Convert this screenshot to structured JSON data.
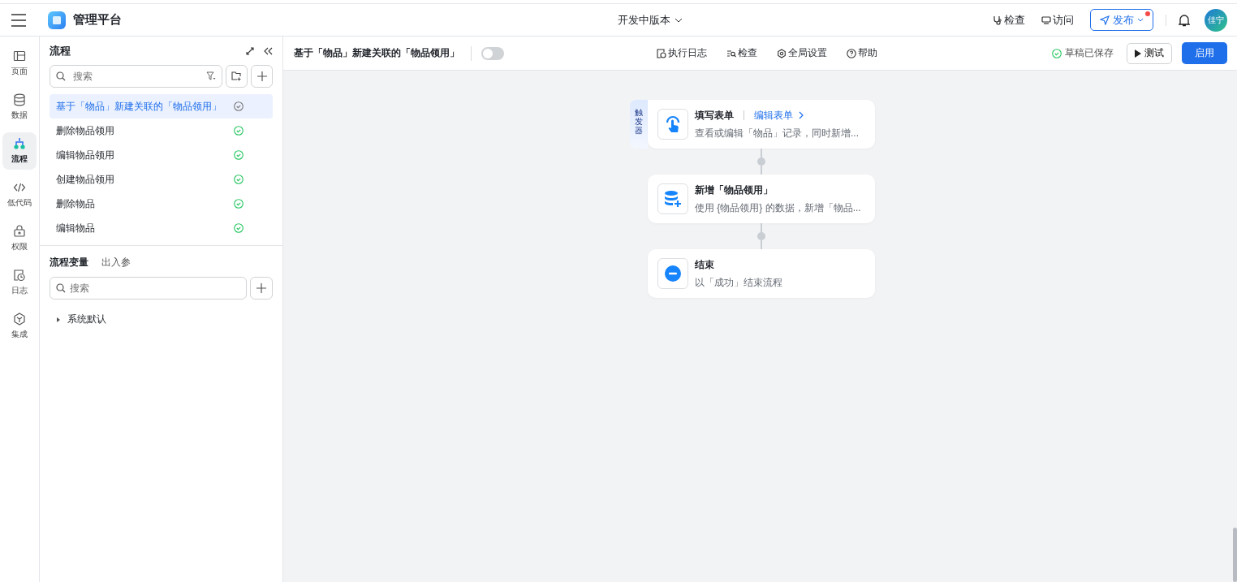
{
  "header": {
    "app_name": "管理平台",
    "version": "开发中版本",
    "actions": [
      {
        "kind": "check",
        "label": "检查"
      },
      {
        "kind": "visit",
        "label": "访问"
      }
    ],
    "publish": {
      "label": "发布",
      "has_dot": true
    },
    "avatar": "佳宁"
  },
  "rail": [
    {
      "kind": "page",
      "label": "页面",
      "selected": false
    },
    {
      "kind": "data",
      "label": "数据",
      "selected": false
    },
    {
      "kind": "flow",
      "label": "流程",
      "selected": true
    },
    {
      "kind": "code",
      "label": "低代码",
      "selected": false
    },
    {
      "kind": "lock",
      "label": "权限",
      "selected": false
    },
    {
      "kind": "log",
      "label": "日志",
      "selected": false
    },
    {
      "kind": "box",
      "label": "集成",
      "selected": false
    }
  ],
  "panel": {
    "title": "流程",
    "search": {
      "placeholder": "搜索"
    },
    "flows": [
      {
        "name": "基于「物品」新建关联的「物品领用」",
        "selected": true
      },
      {
        "name": "删除物品领用",
        "selected": false
      },
      {
        "name": "编辑物品领用",
        "selected": false
      },
      {
        "name": "创建物品领用",
        "selected": false
      },
      {
        "name": "删除物品",
        "selected": false
      },
      {
        "name": "编辑物品",
        "selected": false
      }
    ],
    "var_tabs": [
      {
        "label": "流程变量",
        "selected": true
      },
      {
        "label": "出入参",
        "selected": false
      }
    ],
    "var_search": {
      "placeholder": "搜索"
    },
    "tree": [
      {
        "label": "系统默认",
        "expanded": false
      }
    ]
  },
  "toolbar": {
    "title": "基于「物品」新建关联的「物品领用」",
    "toggle_on": false,
    "tools": [
      {
        "kind": "log",
        "label": "执行日志"
      },
      {
        "kind": "check",
        "label": "检查"
      },
      {
        "kind": "settings",
        "label": "全局设置"
      },
      {
        "kind": "help",
        "label": "帮助"
      }
    ],
    "saved": "草稿已保存",
    "test": "测试",
    "enable": "启用"
  },
  "nodes": [
    {
      "kind": "trigger",
      "badge": "触发器",
      "title": "填写表单",
      "link": "编辑表单",
      "desc": "查看或编辑「物品」记录，同时新增..."
    },
    {
      "kind": "create",
      "title": "新增「物品领用」",
      "desc": "使用 {物品领用} 的数据，新增「物品..."
    },
    {
      "kind": "end",
      "title": "结束",
      "desc": "以「成功」结束流程"
    }
  ]
}
